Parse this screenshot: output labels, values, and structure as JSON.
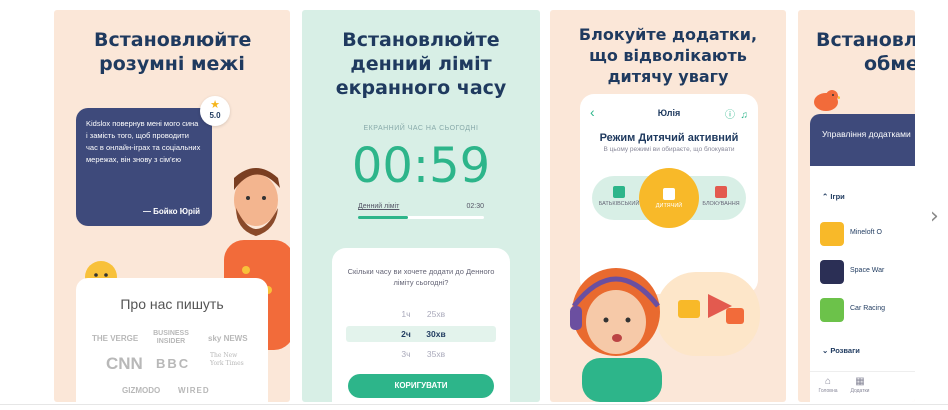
{
  "cards": [
    {
      "heading": "Встановлюйте розумні межі",
      "rating": {
        "star": "★",
        "value": "5.0"
      },
      "quote": "Kidslox повернув мені мого сина і замість того, щоб проводити час в онлайн-іграх та соціальних мережах, він знову з сім'єю",
      "quote_author": "— Бойко Юрій",
      "press_title": "Про нас пишуть",
      "press_logos": [
        "THE VERGE",
        "BUSINESS INSIDER",
        "sky NEWS",
        "CNN",
        "BBC",
        "The New York Times",
        "GIZMODO",
        "WIRED"
      ]
    },
    {
      "heading": "Встановлюйте денний ліміт екранного часу",
      "caption": "ЕКРАННИЙ ЧАС НА СЬОГОДНІ",
      "timer": "00:59",
      "limit_label": "Денний ліміт",
      "limit_value": "02:30",
      "limit_progress": 0.4,
      "question": "Скільки часу ви хочете додати до Денного ліміту сьогодні?",
      "picker": [
        {
          "h": "1ч",
          "m": "25хв"
        },
        {
          "h": "2ч",
          "m": "30хв"
        },
        {
          "h": "3ч",
          "m": "35хв"
        }
      ],
      "picker_selected": 1,
      "button": "КОРИГУВАТИ"
    },
    {
      "heading": "Блокуйте додатки, що відволікають дитячу увагу",
      "profile_name": "Юлія",
      "mode_title": "Режим Дитячий активний",
      "mode_subtitle": "В цьому режимі ви обираєте, що блокувати",
      "modes": [
        "БАТЬКІВСЬКИЙ",
        "ДИТЯЧИЙ",
        "БЛОКУВАННЯ"
      ],
      "active_mode": 1,
      "colors": {
        "parent": "#2db58a",
        "child": "#f8b929",
        "block": "#e35a4f"
      }
    },
    {
      "heading_line1": "Встановлю",
      "heading_line2": "обмеж",
      "panel_header": "Управління додатками",
      "section_games": "Ігри",
      "apps": [
        "Mineloft O",
        "Space War",
        "Car Racing"
      ],
      "section_more": "Розваги",
      "tabs": [
        "Головна",
        "Додатки"
      ]
    }
  ],
  "nav": {
    "next": "›"
  }
}
